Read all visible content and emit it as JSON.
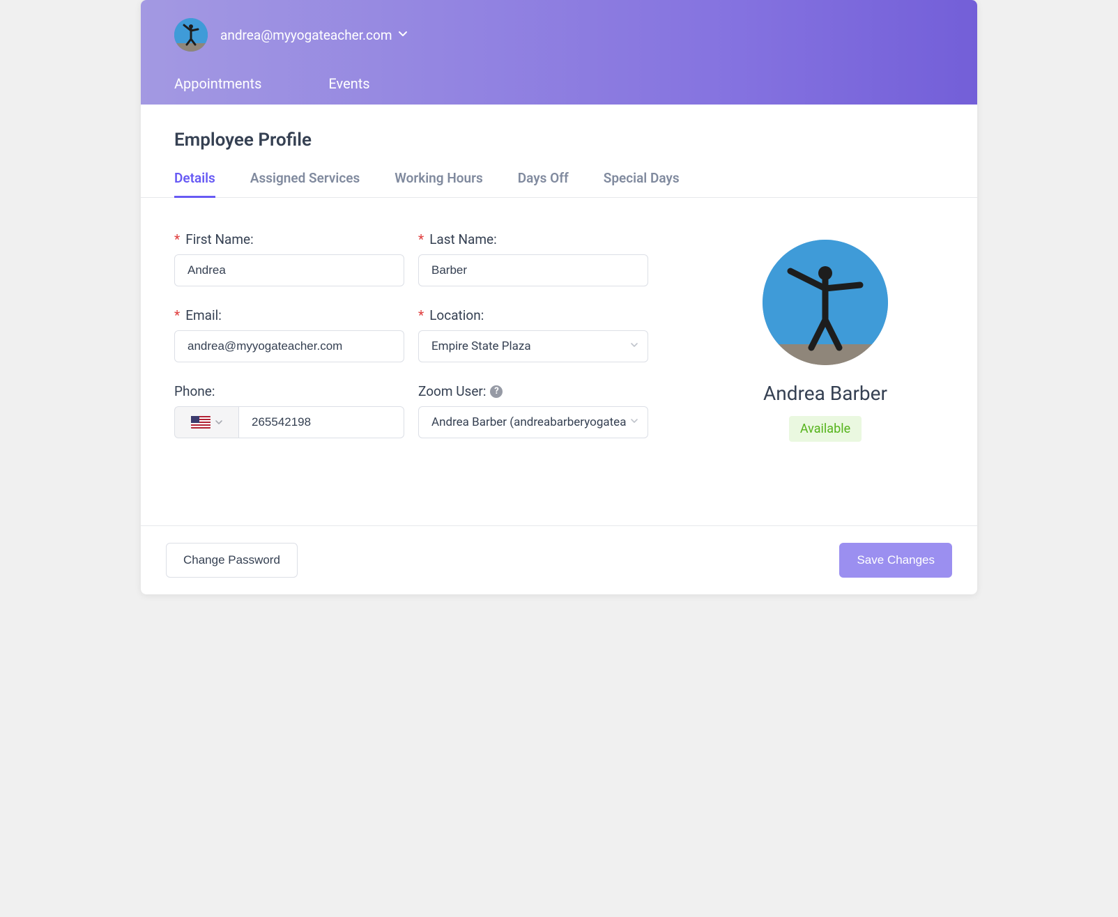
{
  "header": {
    "user_email": "andrea@myyogateacher.com",
    "nav": {
      "appointments": "Appointments",
      "events": "Events"
    }
  },
  "page": {
    "title": "Employee Profile"
  },
  "tabs": {
    "details": "Details",
    "assigned_services": "Assigned Services",
    "working_hours": "Working Hours",
    "days_off": "Days Off",
    "special_days": "Special Days"
  },
  "form": {
    "first_name": {
      "label": "First Name:",
      "value": "Andrea"
    },
    "last_name": {
      "label": "Last Name:",
      "value": "Barber"
    },
    "email": {
      "label": "Email:",
      "value": "andrea@myyogateacher.com"
    },
    "location": {
      "label": "Location:",
      "value": "Empire State Plaza"
    },
    "phone": {
      "label": "Phone:",
      "value": "265542198"
    },
    "zoom_user": {
      "label": "Zoom User:",
      "value": "Andrea Barber (andreabarberyogatea"
    }
  },
  "profile": {
    "name": "Andrea Barber",
    "status": "Available"
  },
  "footer": {
    "change_password": "Change Password",
    "save_changes": "Save Changes"
  }
}
